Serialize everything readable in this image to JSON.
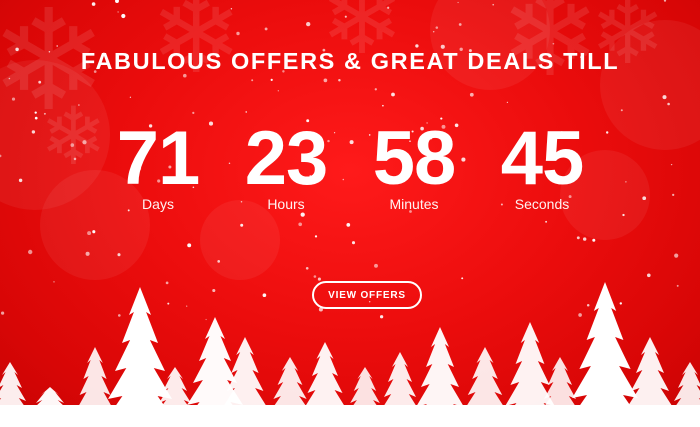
{
  "promo": {
    "headline": "FABULOUS OFFERS & GREAT DEALS TILL",
    "cta_label": "VIEW OFFERS"
  },
  "countdown": [
    {
      "value": "71",
      "label": "Days"
    },
    {
      "value": "23",
      "label": "Hours"
    },
    {
      "value": "58",
      "label": "Minutes"
    },
    {
      "value": "45",
      "label": "Seconds"
    }
  ],
  "colors": {
    "background": "#ec0d0d",
    "text": "#ffffff",
    "trees": "#ffffff"
  },
  "icons": [
    "snowflake-icon",
    "pine-tree-icon"
  ]
}
